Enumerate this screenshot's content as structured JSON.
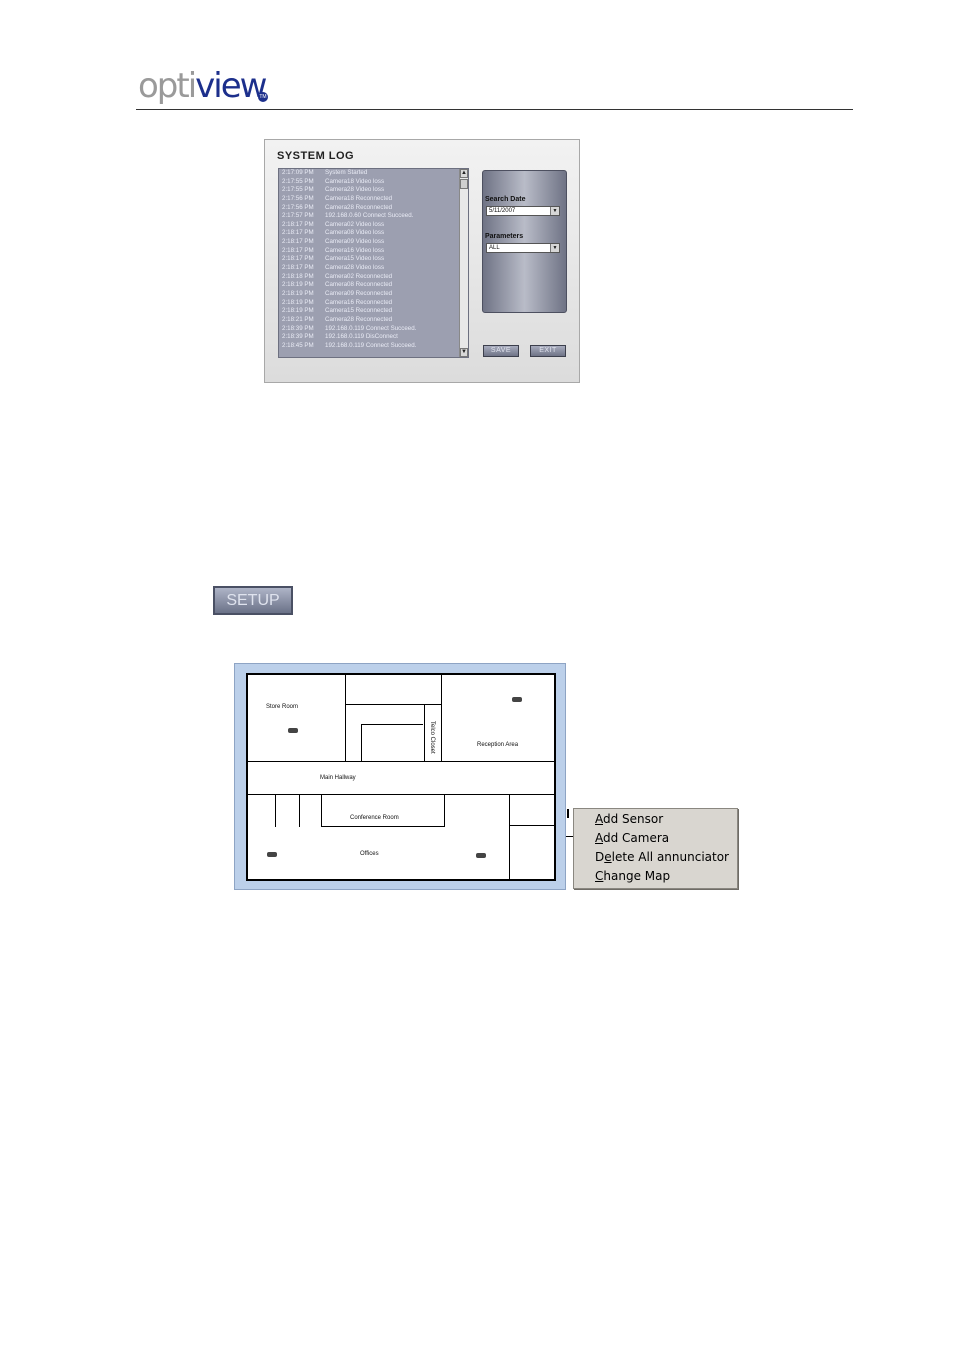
{
  "header": {
    "logo_part1": "opti",
    "logo_part2": "view",
    "logo_badge": "TM",
    "brand_color": "#1c2f8c"
  },
  "system_log": {
    "title": "SYSTEM LOG",
    "entries": [
      {
        "time": "2:17:09 PM",
        "message": "System Started"
      },
      {
        "time": "2:17:55 PM",
        "message": "Camera18 Video loss"
      },
      {
        "time": "2:17:55 PM",
        "message": "Camera28 Video loss"
      },
      {
        "time": "2:17:56 PM",
        "message": "Camera18 Reconnected"
      },
      {
        "time": "2:17:56 PM",
        "message": "Camera28 Reconnected"
      },
      {
        "time": "2:17:57 PM",
        "message": "192.168.0.60 Connect Succeed."
      },
      {
        "time": "2:18:17 PM",
        "message": "Camera02 Video loss"
      },
      {
        "time": "2:18:17 PM",
        "message": "Camera08 Video loss"
      },
      {
        "time": "2:18:17 PM",
        "message": "Camera09 Video loss"
      },
      {
        "time": "2:18:17 PM",
        "message": "Camera16 Video loss"
      },
      {
        "time": "2:18:17 PM",
        "message": "Camera15 Video loss"
      },
      {
        "time": "2:18:17 PM",
        "message": "Camera28 Video loss"
      },
      {
        "time": "2:18:18 PM",
        "message": "Camera02 Reconnected"
      },
      {
        "time": "2:18:19 PM",
        "message": "Camera08 Reconnected"
      },
      {
        "time": "2:18:19 PM",
        "message": "Camera09 Reconnected"
      },
      {
        "time": "2:18:19 PM",
        "message": "Camera16 Reconnected"
      },
      {
        "time": "2:18:19 PM",
        "message": "Camera15 Reconnected"
      },
      {
        "time": "2:18:21 PM",
        "message": "Camera28 Reconnected"
      },
      {
        "time": "2:18:39 PM",
        "message": "192.168.0.119 Connect Succeed."
      },
      {
        "time": "2:18:39 PM",
        "message": "192.168.0.119 DisConnect"
      },
      {
        "time": "2:18:45 PM",
        "message": "192.168.0.119 Connect Succeed."
      }
    ],
    "search_date_label": "Search Date",
    "search_date_value": "5/11/2007",
    "parameters_label": "Parameters",
    "parameters_value": "ALL",
    "save_label": "SAVE",
    "exit_label": "EXIT"
  },
  "setup_button": {
    "label": "SETUP"
  },
  "floor_map": {
    "rooms": {
      "store_room": "Store Room",
      "telco_closet": "Telco Closet",
      "reception_area": "Reception Area",
      "main_hallway": "Main Hallway",
      "conference_room": "Conference Room",
      "offices": "Offices"
    }
  },
  "context_menu": {
    "items": [
      {
        "mnemonic": "A",
        "rest": "dd Sensor"
      },
      {
        "mnemonic": "A",
        "rest": "dd Camera"
      },
      {
        "pre": "D",
        "mnemonic": "e",
        "rest": "lete All annunciator"
      },
      {
        "mnemonic": "C",
        "rest": "hange Map"
      }
    ]
  }
}
